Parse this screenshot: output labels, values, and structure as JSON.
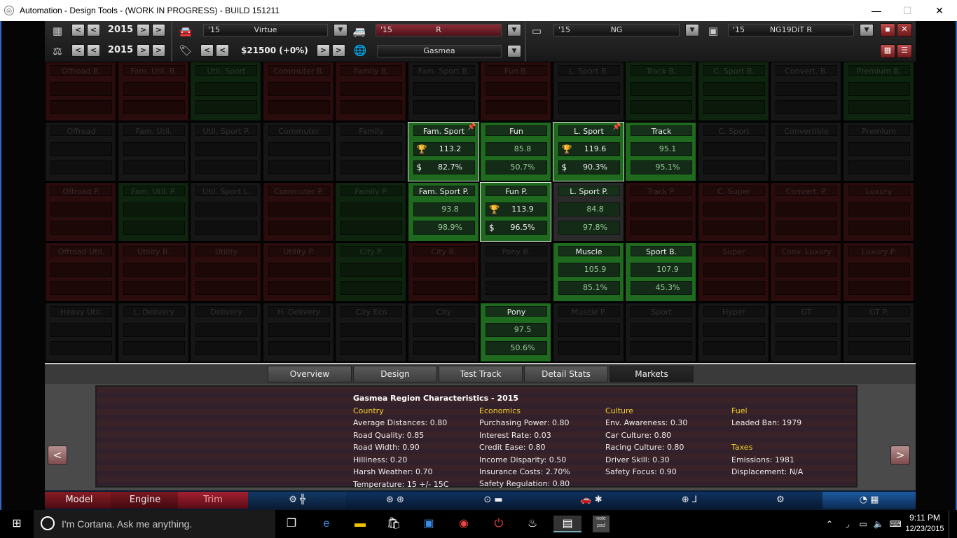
{
  "window": {
    "title": "Automation - Design Tools - (WORK IN PROGRESS) - BUILD 151211",
    "minimize": "—",
    "maximize": "☐",
    "close": "✕"
  },
  "toolbar": {
    "year1": "2015",
    "year2": "2015",
    "price": "$21500 (+0%)",
    "model_year": "'15",
    "model_name": "Virtue",
    "trim_year": "'15",
    "trim_name": "R",
    "engine_year": "'15",
    "engine_name": "NG",
    "variant_year": "'15",
    "variant_name": "NG19DiT R",
    "region": "Gasmea",
    "icons": [
      "calendar-icon",
      "scale-icon",
      "car-icon",
      "tag-icon",
      "globe-icon",
      "van-icon",
      "engine-block-icon",
      "engine-variant-icon",
      "save-icon",
      "close-icon",
      "grid-view-icon",
      "list-view-icon"
    ]
  },
  "grid": {
    "rows": [
      [
        {
          "label": "Offroad B.",
          "tone": "red",
          "state": "dim"
        },
        {
          "label": "Fam. Util. B.",
          "tone": "red",
          "state": "dim"
        },
        {
          "label": "Util. Sport",
          "tone": "green",
          "state": "dim"
        },
        {
          "label": "Commuter B.",
          "tone": "red",
          "state": "dim"
        },
        {
          "label": "Family B.",
          "tone": "red",
          "state": "dim"
        },
        {
          "label": "Fam. Sport B.",
          "tone": "dark",
          "state": "dim"
        },
        {
          "label": "Fun B.",
          "tone": "red",
          "state": "dim"
        },
        {
          "label": "L. Sport B.",
          "tone": "dark",
          "state": "dim"
        },
        {
          "label": "Track B.",
          "tone": "green",
          "state": "dim"
        },
        {
          "label": "C. Sport B.",
          "tone": "green",
          "state": "dim"
        },
        {
          "label": "Convert. B.",
          "tone": "dark",
          "state": "dim"
        },
        {
          "label": "Premium B.",
          "tone": "green",
          "state": "dim"
        }
      ],
      [
        {
          "label": "Offroad",
          "tone": "dark",
          "state": "dim"
        },
        {
          "label": "Fam. Util.",
          "tone": "dark",
          "state": "dim"
        },
        {
          "label": "Util. Sport P.",
          "tone": "dark",
          "state": "dim"
        },
        {
          "label": "Commuter",
          "tone": "dark",
          "state": "dim"
        },
        {
          "label": "Family",
          "tone": "dark",
          "state": "dim"
        },
        {
          "label": "Fam. Sport",
          "tone": "green",
          "state": "active",
          "selected": true,
          "pinned": true,
          "v1": "113.2",
          "v2": "82.7%",
          "trophy": true,
          "dollar": true
        },
        {
          "label": "Fun",
          "tone": "green",
          "state": "active",
          "v1": "85.8",
          "v2": "50.7%"
        },
        {
          "label": "L. Sport",
          "tone": "green",
          "state": "active",
          "selected": true,
          "pinned": true,
          "v1": "119.6",
          "v2": "90.3%",
          "trophy": true,
          "dollar": true
        },
        {
          "label": "Track",
          "tone": "green",
          "state": "active",
          "v1": "95.1",
          "v2": "95.1%"
        },
        {
          "label": "C. Sport",
          "tone": "dark",
          "state": "dim"
        },
        {
          "label": "Convertible",
          "tone": "dark",
          "state": "dim"
        },
        {
          "label": "Premium",
          "tone": "dark",
          "state": "dim"
        }
      ],
      [
        {
          "label": "Offroad P.",
          "tone": "red",
          "state": "dim"
        },
        {
          "label": "Fam. Util. P.",
          "tone": "green",
          "state": "dim"
        },
        {
          "label": "Util. Sport L.",
          "tone": "dark",
          "state": "dim"
        },
        {
          "label": "Commuter P.",
          "tone": "red",
          "state": "dim"
        },
        {
          "label": "Family P.",
          "tone": "green",
          "state": "dim"
        },
        {
          "label": "Fam. Sport P.",
          "tone": "green",
          "state": "active",
          "v1": "93.8",
          "v2": "98.9%"
        },
        {
          "label": "Fun P.",
          "tone": "green",
          "state": "active",
          "selected": true,
          "v1": "113.9",
          "v2": "96.5%",
          "trophy": true,
          "dollar": true
        },
        {
          "label": "L. Sport P.",
          "tone": "dark",
          "state": "active",
          "v1": "84.8",
          "v2": "97.8%"
        },
        {
          "label": "Track P.",
          "tone": "red",
          "state": "dim"
        },
        {
          "label": "C. Super",
          "tone": "red",
          "state": "dim"
        },
        {
          "label": "Convert. P.",
          "tone": "red",
          "state": "dim"
        },
        {
          "label": "Luxury",
          "tone": "red",
          "state": "dim"
        }
      ],
      [
        {
          "label": "Offroad Util.",
          "tone": "red",
          "state": "dim"
        },
        {
          "label": "Utility B.",
          "tone": "red",
          "state": "dim"
        },
        {
          "label": "Utility",
          "tone": "red",
          "state": "dim"
        },
        {
          "label": "Utility P.",
          "tone": "red",
          "state": "dim"
        },
        {
          "label": "City P.",
          "tone": "green",
          "state": "dim"
        },
        {
          "label": "City B.",
          "tone": "red",
          "state": "dim"
        },
        {
          "label": "Pony B.",
          "tone": "dark",
          "state": "dim"
        },
        {
          "label": "Muscle",
          "tone": "green",
          "state": "active",
          "v1": "105.9",
          "v2": "85.1%"
        },
        {
          "label": "Sport B.",
          "tone": "green",
          "state": "active",
          "v1": "107.9",
          "v2": "45.3%"
        },
        {
          "label": "Super",
          "tone": "red",
          "state": "dim"
        },
        {
          "label": "Conv. Luxury",
          "tone": "red",
          "state": "dim"
        },
        {
          "label": "Luxury P.",
          "tone": "red",
          "state": "dim"
        }
      ],
      [
        {
          "label": "Heavy Util.",
          "tone": "dark",
          "state": "dim"
        },
        {
          "label": "L. Delivery",
          "tone": "dark",
          "state": "dim"
        },
        {
          "label": "Delivery",
          "tone": "dark",
          "state": "dim"
        },
        {
          "label": "H. Delivery",
          "tone": "dark",
          "state": "dim"
        },
        {
          "label": "City Eco",
          "tone": "dark",
          "state": "dim"
        },
        {
          "label": "City",
          "tone": "dark",
          "state": "dim"
        },
        {
          "label": "Pony",
          "tone": "green",
          "state": "active",
          "v1": "97.5",
          "v2": "50.6%"
        },
        {
          "label": "Muscle P.",
          "tone": "dark",
          "state": "dim"
        },
        {
          "label": "Sport",
          "tone": "dark",
          "state": "dim"
        },
        {
          "label": "Hyper",
          "tone": "dark",
          "state": "dim"
        },
        {
          "label": "GT",
          "tone": "dark",
          "state": "dim"
        },
        {
          "label": "GT P.",
          "tone": "dark",
          "state": "dim"
        }
      ]
    ]
  },
  "tabs": [
    "Overview",
    "Design",
    "Test Track",
    "Detail Stats",
    "Markets"
  ],
  "active_tab": "Markets",
  "panel": {
    "title": "Gasmea Region Characteristics - 2015",
    "prev": "<",
    "next": ">",
    "columns": [
      {
        "heading": "Country",
        "rows": [
          "Average Distances:  0.80",
          "Road Quality:  0.85",
          "Road Width:  0.90",
          "Hilliness:  0.20",
          "Harsh Weather:  0.70",
          "Temperature:  15 +/- 15C"
        ]
      },
      {
        "heading": "Economics",
        "rows": [
          "Purchasing Power:  0.80",
          "Interest Rate:  0.03",
          "Credit Ease:  0.80",
          "Income Disparity:  0.50",
          "Insurance Costs:  2.70%",
          "Safety Regulation:  0.80"
        ]
      },
      {
        "heading": "Culture",
        "rows": [
          "Env. Awareness:  0.30",
          "Car Culture:  0.80",
          "Racing Culture:  0.80",
          "Driver Skill:  0.30",
          "Safety Focus:  0.90"
        ]
      },
      {
        "heading": "Fuel",
        "rows": [
          "Leaded Ban:  1979"
        ]
      },
      {
        "heading": "Taxes",
        "rows": [
          "Emissions:  1981",
          "Displacement: N/A"
        ]
      }
    ]
  },
  "bottom_nav": [
    "Model",
    "Engine",
    "Trim"
  ],
  "taskbar": {
    "cortana": "I'm Cortana. Ask me anything.",
    "time": "9:11 PM",
    "date": "12/23/2015",
    "notepad": "note pad"
  },
  "colors": {
    "green_active": "#1f6a1f",
    "green_dim": "#0f240f",
    "red_dim": "#2a0c0c",
    "dark_dim": "#161616",
    "accent_yellow": "#f2d22e"
  }
}
